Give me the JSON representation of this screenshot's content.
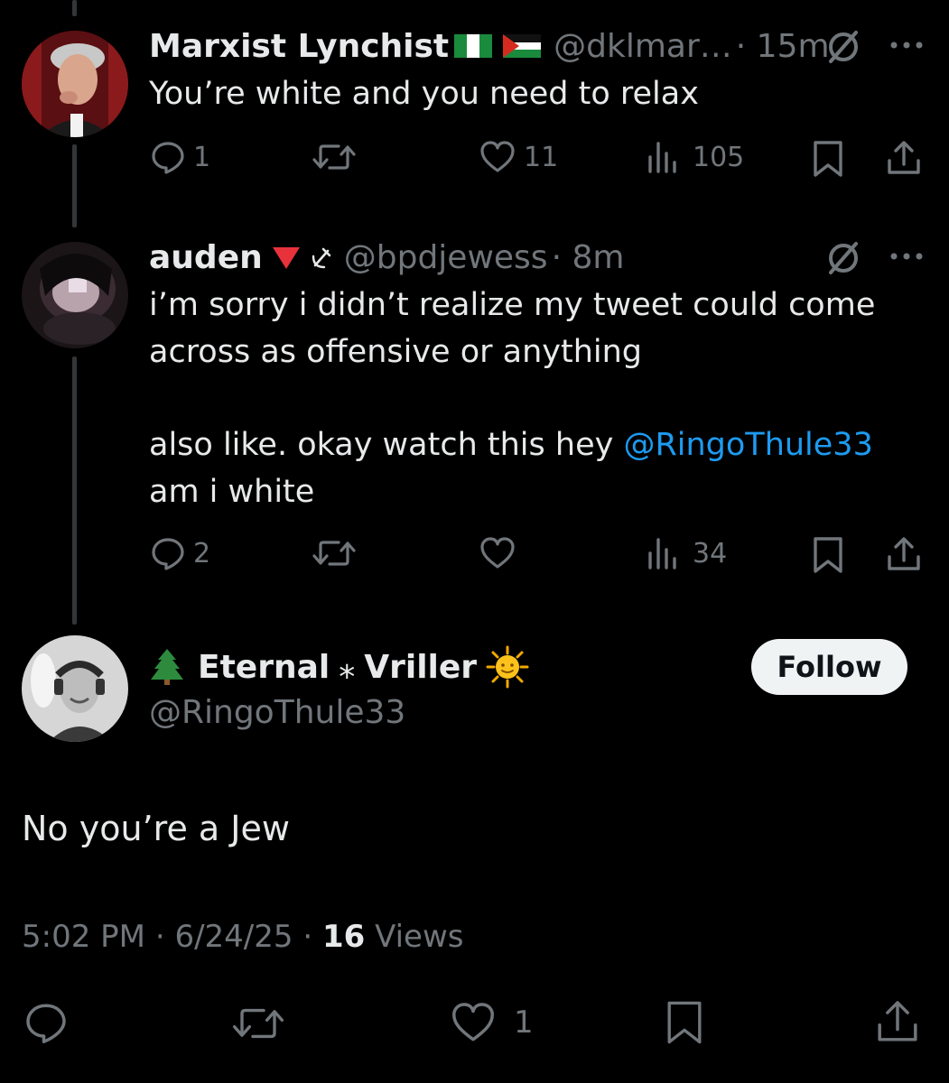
{
  "tweets": [
    {
      "name": "Marxist Lynchist",
      "handle": "@dklmar…",
      "time": "· 15m",
      "text": "You’re white and you need to relax",
      "replies": "1",
      "retweets": "",
      "likes": "11",
      "views": "105"
    },
    {
      "name": "auden",
      "handle": "@bpdjewess",
      "time": "· 8m",
      "text_line1": "i’m sorry i didn’t realize my tweet could come",
      "text_line2": "across as offensive or anything",
      "text_line3_pre": "also like. okay watch this hey ",
      "mention": "@RingoThule33",
      "text_line4": "am i white",
      "replies": "2",
      "retweets": "",
      "likes": "",
      "views": "34"
    }
  ],
  "main_tweet": {
    "name_part1": "Eternal",
    "name_part2": "Vriller",
    "separator_glyph": "⁎",
    "handle": "@RingoThule33",
    "follow_label": "Follow",
    "text": "No you’re a Jew",
    "time": "5:02 PM",
    "date": "6/24/25",
    "views_count": "16",
    "views_label": "Views",
    "likes": "1"
  },
  "colors": {
    "background": "#000000",
    "text": "#e7e9ea",
    "secondary": "#71767b",
    "link": "#1d9bf0",
    "thread_line": "#333639"
  },
  "icons": [
    "grok-icon",
    "more-icon",
    "reply-icon",
    "retweet-icon",
    "like-icon",
    "views-icon",
    "bookmark-icon",
    "share-icon",
    "tree-emoji",
    "sun-emoji",
    "red-triangle-emoji",
    "hammer-sickle-icon"
  ]
}
